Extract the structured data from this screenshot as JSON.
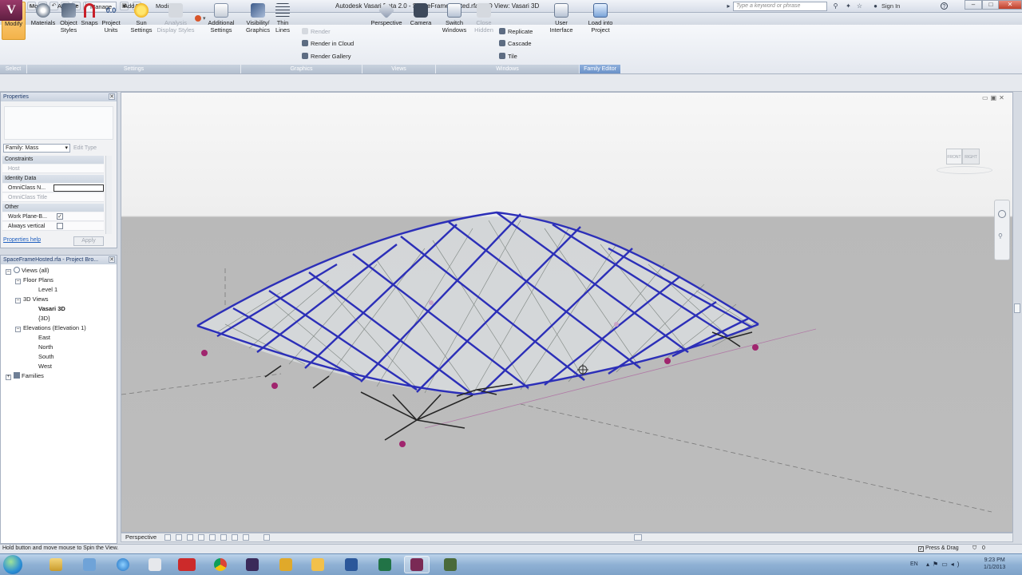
{
  "app": {
    "title": "Autodesk Vasari Beta 2.0 -   SpaceFrameHosted.rfa - 3D View: Vasari 3D",
    "logo": "V",
    "search_placeholder": "Type a keyword or phrase",
    "sign_in": "Sign In"
  },
  "tabs": [
    "Model",
    "Analyze",
    "Manage",
    "Add-Ins",
    "Modify"
  ],
  "ribbon": {
    "modify": "Modify",
    "materials": "Materials",
    "object_styles": "Object Styles",
    "snaps": "Snaps",
    "project_units": "Project Units",
    "sun_settings": "Sun Settings",
    "analysis_display_styles": "Analysis Display Styles",
    "additional_settings": "Additional Settings",
    "visibility_graphics": "Visibility/ Graphics",
    "thin_lines": "Thin Lines",
    "render": "Render",
    "render_in_cloud": "Render in Cloud",
    "render_gallery": "Render Gallery",
    "perspective": "Perspective",
    "camera": "Camera",
    "switch_windows": "Switch Windows",
    "close_hidden": "Close Hidden",
    "replicate": "Replicate",
    "cascade": "Cascade",
    "tile": "Tile",
    "user_interface": "User Interface",
    "load_into_project": "Load into Project",
    "panels": {
      "select": "Select",
      "settings": "Settings",
      "graphics": "Graphics",
      "views": "Views",
      "windows": "Windows",
      "family_editor": "Family Editor"
    }
  },
  "properties": {
    "header": "Properties",
    "type_selector": "Family: Mass",
    "edit_type": "Edit Type",
    "groups": {
      "constraints": "Constraints",
      "identity": "Identity Data",
      "other": "Other"
    },
    "rows": {
      "host": "Host",
      "omniclass_number": "OmniClass N...",
      "omniclass_title": "OmniClass Title",
      "work_plane": "Work Plane-B...",
      "always_vertical": "Always vertical"
    },
    "help": "Properties help",
    "apply": "Apply"
  },
  "browser": {
    "header": "SpaceFrameHosted.rfa - Project Bro...",
    "views_all": "Views (all)",
    "floor_plans": "Floor Plans",
    "level_1": "Level 1",
    "views_3d": "3D Views",
    "vasari_3d": "Vasari 3D",
    "view_3d": "{3D}",
    "elevations": "Elevations (Elevation 1)",
    "east": "East",
    "north": "North",
    "south": "South",
    "west": "West",
    "families": "Families"
  },
  "viewcube": {
    "front": "FRONT",
    "right": "RIGHT"
  },
  "viewbar": {
    "scale": "Perspective"
  },
  "status": {
    "text": "Hold button and move mouse to Spin the View.",
    "press_drag": "Press & Drag",
    "zero": "0"
  },
  "tray": {
    "lang": "EN",
    "time": "9:23 PM",
    "date": "1/1/2013"
  },
  "taskbar_apps": [
    "explorer",
    "library",
    "ie",
    "browser2",
    "rsa",
    "chrome",
    "app-x",
    "app-v",
    "folder",
    "word",
    "excel",
    "vasari",
    "app-g"
  ],
  "colors": {
    "frame_blue": "#2c2fb8",
    "frame_dark": "#2a2a2a",
    "ground": "#bdbdbd",
    "grip_magenta": "#a0256e",
    "ribbon_accent": "#7fa2d6"
  }
}
